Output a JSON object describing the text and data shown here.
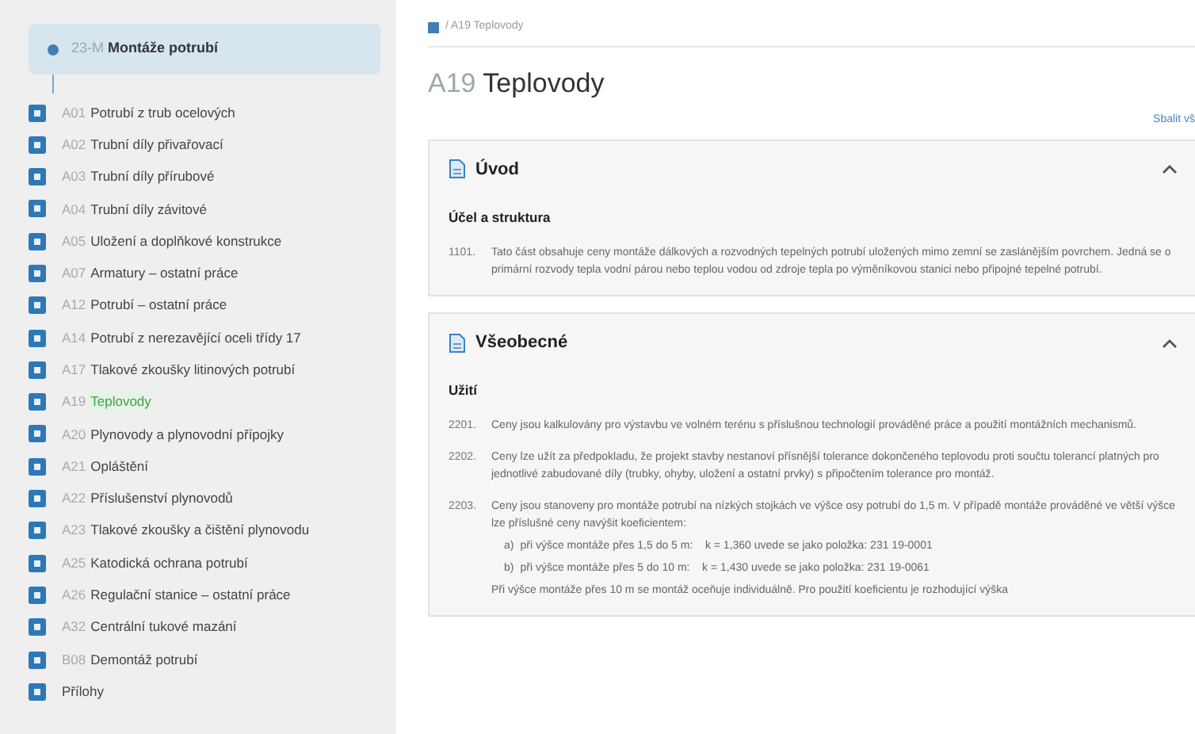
{
  "sidebar": {
    "root": {
      "code": "23-M",
      "label": "Montáže potrubí",
      "selected": true,
      "expanded": true
    },
    "items": [
      {
        "code": "A01",
        "label": "Potrubí z trub ocelových",
        "selected": false
      },
      {
        "code": "A02",
        "label": "Trubní díly přivařovací",
        "selected": false
      },
      {
        "code": "A03",
        "label": "Trubní díly přírubové",
        "selected": false
      },
      {
        "code": "A04",
        "label": "Trubní díly závitové",
        "selected": false
      },
      {
        "code": "A05",
        "label": "Uložení a doplňkové konstrukce",
        "selected": false
      },
      {
        "code": "A07",
        "label": "Armatury – ostatní práce",
        "selected": false
      },
      {
        "code": "A12",
        "label": "Potrubí – ostatní práce",
        "selected": false
      },
      {
        "code": "A14",
        "label": "Potrubí z nerezavějící oceli třídy 17",
        "selected": false
      },
      {
        "code": "A17",
        "label": "Tlakové zkoušky litinových potrubí",
        "selected": false
      },
      {
        "code": "A19",
        "label": "Teplovody",
        "selected": true
      },
      {
        "code": "A20",
        "label": "Plynovody a plynovodní přípojky",
        "selected": false
      },
      {
        "code": "A21",
        "label": "Opláštění",
        "selected": false
      },
      {
        "code": "A22",
        "label": "Příslušenství plynovodů",
        "selected": false
      },
      {
        "code": "A23",
        "label": "Tlakové zkoušky a čištění plynovodu",
        "selected": false
      },
      {
        "code": "A25",
        "label": "Katodická ochrana potrubí",
        "selected": false
      },
      {
        "code": "A26",
        "label": "Regulační stanice – ostatní práce",
        "selected": false
      },
      {
        "code": "A32",
        "label": "Centrální tukové mazání",
        "selected": false
      },
      {
        "code": "B08",
        "label": "Demontáž potrubí",
        "selected": false
      },
      {
        "label": "Přílohy",
        "selected": false
      }
    ]
  },
  "main": {
    "breadcrumb": "/ A19 Teplovody",
    "title": {
      "code": "A19",
      "name": "Teplovody"
    },
    "collapse_link": "Sbalit vš",
    "sections": [
      {
        "title": "Úvod",
        "expanded": true,
        "subheading": "Účel a struktura",
        "paragraphs": [
          {
            "number": "1101.",
            "text": "Tato část obsahuje ceny montáže dálkových a rozvodných tepelných potrubí uložených mimo zemní se zaslánějším povrchem. Jedná se o primární rozvody tepla vodní párou nebo teplou vodou od zdroje tepla po výměníkovou stanici nebo připojné tepelné potrubí."
          }
        ]
      },
      {
        "title": "Všeobecné",
        "expanded": true,
        "subheading": "Užití",
        "paragraphs": [
          {
            "number": "2201.",
            "text": "Ceny jsou kalkulovány pro výstavbu ve volném terénu s příslušnou technologií prováděné práce a použití montážních mechanismů."
          },
          {
            "number": "2202.",
            "text": "Ceny lze užít za předpokladu, že projekt stavby nestanoví přísnější tolerance dokončeného teplovodu proti součtu tolerancí platných pro jednotlivé zabudované díly (trubky, ohyby, uložení a ostatní prvky) s připočtením tolerance pro montáž."
          },
          {
            "number": "2203.",
            "text": "Ceny jsou stanoveny pro montáže potrubí na nízkých stojkách ve výšce osy potrubí do 1,5 m. V případě montáže prováděné ve větší výšce lze příslušné ceny navýšit koeficientem:",
            "sub_items": [
              {
                "marker": "a)",
                "text": "při výšce montáže přes 1,5 do 5 m:    k = 1,360 uvede se jako položka: 231 19-0001"
              },
              {
                "marker": "b)",
                "text": "při výšce montáže přes 5 do 10 m:    k = 1,430 uvede se jako položka: 231 19-0061"
              }
            ],
            "note": "Při výšce montáže přes 10 m se montáž oceňuje individuálně. Pro použití koeficientu je rozhodující výška"
          }
        ]
      }
    ]
  }
}
